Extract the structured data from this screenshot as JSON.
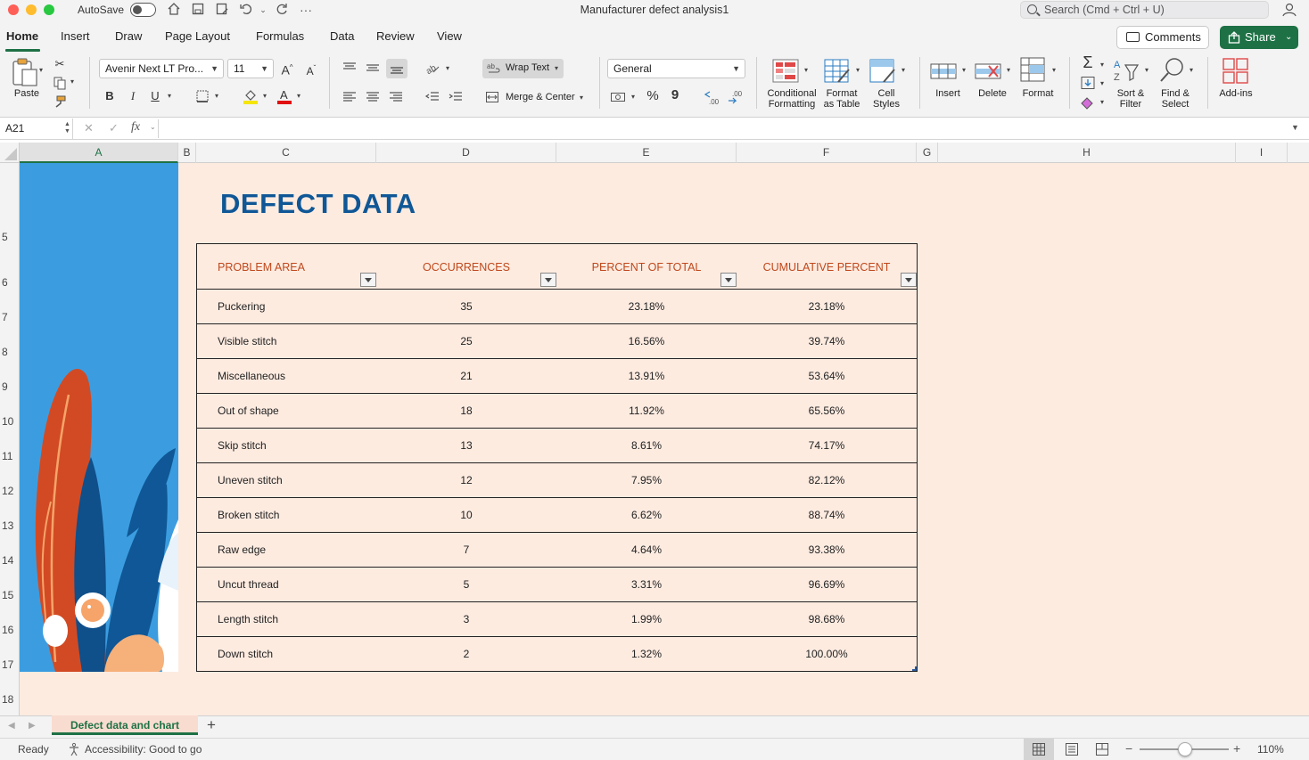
{
  "window": {
    "autosave_label": "AutoSave",
    "title": "Manufacturer defect analysis1",
    "search_placeholder": "Search (Cmd + Ctrl + U)"
  },
  "tabs": [
    {
      "label": "Home",
      "active": true
    },
    {
      "label": "Insert"
    },
    {
      "label": "Draw"
    },
    {
      "label": "Page Layout"
    },
    {
      "label": "Formulas"
    },
    {
      "label": "Data"
    },
    {
      "label": "Review"
    },
    {
      "label": "View"
    }
  ],
  "actions": {
    "comments": "Comments",
    "share": "Share"
  },
  "ribbon": {
    "paste": "Paste",
    "font_name": "Avenir Next LT Pro...",
    "font_size": "11",
    "wrap_text": "Wrap Text",
    "merge_center": "Merge & Center",
    "number_format": "General",
    "conditional_formatting": [
      "Conditional",
      "Formatting"
    ],
    "format_as_table": [
      "Format",
      "as Table"
    ],
    "cell_styles": [
      "Cell",
      "Styles"
    ],
    "insert": "Insert",
    "delete": "Delete",
    "format": "Format",
    "sort_filter": [
      "Sort &",
      "Filter"
    ],
    "find_select": [
      "Find &",
      "Select"
    ],
    "add_ins": "Add-ins",
    "bold": "B",
    "italic": "I",
    "underline": "U",
    "percent": "%",
    "comma": "9"
  },
  "formula_bar": {
    "name_box": "A21",
    "fx": "fx",
    "value": ""
  },
  "columns": [
    "A",
    "B",
    "C",
    "D",
    "E",
    "F",
    "G",
    "H",
    "I"
  ],
  "rows": [
    "5",
    "6",
    "7",
    "8",
    "9",
    "10",
    "11",
    "12",
    "13",
    "14",
    "15",
    "16",
    "17",
    "18"
  ],
  "sheet": {
    "title": "DEFECT DATA",
    "headers": [
      "PROBLEM AREA",
      "OCCURRENCES",
      "PERCENT OF TOTAL",
      "CUMULATIVE PERCENT"
    ],
    "data": [
      [
        "Puckering",
        "35",
        "23.18%",
        "23.18%"
      ],
      [
        "Visible stitch",
        "25",
        "16.56%",
        "39.74%"
      ],
      [
        "Miscellaneous",
        "21",
        "13.91%",
        "53.64%"
      ],
      [
        "Out of shape",
        "18",
        "11.92%",
        "65.56%"
      ],
      [
        "Skip stitch",
        "13",
        "8.61%",
        "74.17%"
      ],
      [
        "Uneven stitch",
        "12",
        "7.95%",
        "82.12%"
      ],
      [
        "Broken stitch",
        "10",
        "6.62%",
        "88.74%"
      ],
      [
        "Raw edge",
        "7",
        "4.64%",
        "93.38%"
      ],
      [
        "Uncut thread",
        "5",
        "3.31%",
        "96.69%"
      ],
      [
        "Length stitch",
        "3",
        "1.99%",
        "98.68%"
      ],
      [
        "Down stitch",
        "2",
        "1.32%",
        "100.00%"
      ]
    ]
  },
  "sheet_tab": "Defect data and chart",
  "status": {
    "ready": "Ready",
    "accessibility": "Accessibility: Good to go",
    "zoom": "110%"
  },
  "colors": {
    "accent": "#1e7145",
    "title_blue": "#0f5796",
    "header_orange": "#c0481c",
    "sheet_bg": "#fdebe0",
    "panel_blue": "#3b9de0"
  }
}
